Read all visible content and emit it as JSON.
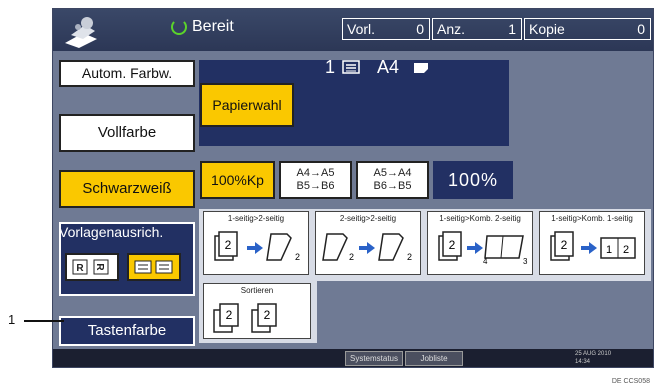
{
  "status": {
    "text": "Bereit",
    "icon": "ready-circle-icon"
  },
  "counters": [
    {
      "label": "Vorl.",
      "value": "0"
    },
    {
      "label": "Anz.",
      "value": "1"
    },
    {
      "label": "Kopie",
      "value": "0"
    }
  ],
  "color_buttons": {
    "auto": "Autom. Farbw.",
    "full": "Vollfarbe",
    "bw": "Schwarzweiß"
  },
  "paper": {
    "button": "Papierwahl",
    "tray": "1",
    "size": "A4"
  },
  "zoom": {
    "full_size": "100%Kp",
    "reduce": [
      "A4→A5",
      "B5→B6"
    ],
    "enlarge": [
      "A5→A4",
      "B6→B5"
    ],
    "display": "100%"
  },
  "orientation": {
    "label": "Vorlagenausrich."
  },
  "duplex": [
    {
      "caption": "1-seitig>2-seitig"
    },
    {
      "caption": "2-seitig>2-seitig"
    },
    {
      "caption": "1-seitig>Komb. 2-seitig"
    },
    {
      "caption": "1-seitig>Komb. 1-seitig"
    }
  ],
  "sort": {
    "caption": "Sortieren"
  },
  "key_color": {
    "label": "Tastenfarbe"
  },
  "callout": {
    "number": "1"
  },
  "bottom_bar": {
    "buttons": [
      "Systemstatus",
      "Jobliste"
    ],
    "date": "25 AUG 2010",
    "time": "14:34"
  },
  "footer": {
    "code": "DE CCS058"
  },
  "colors": {
    "accent_yellow": "#fac800",
    "navy": "#223063",
    "panel": "#6f7a94",
    "ready_green": "#5bd42a"
  }
}
